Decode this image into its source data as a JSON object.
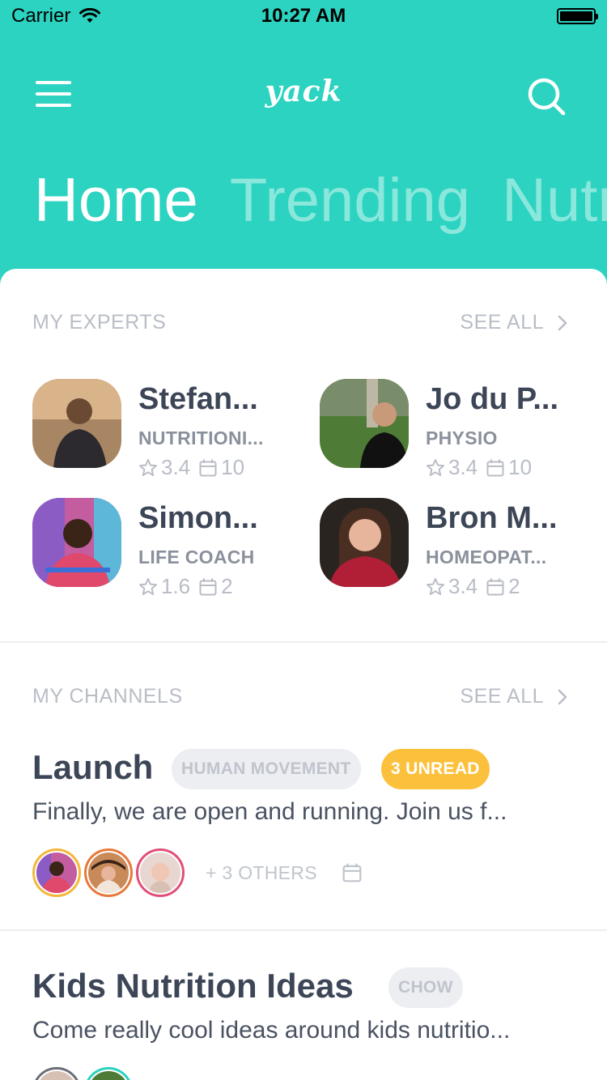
{
  "status_bar": {
    "carrier": "Carrier",
    "time": "10:27 AM"
  },
  "navbar": {
    "logo": "yack"
  },
  "tabs": [
    {
      "label": "Home",
      "active": true
    },
    {
      "label": "Trending",
      "active": false
    },
    {
      "label": "Nutr",
      "active": false
    }
  ],
  "experts_section": {
    "header": "MY EXPERTS",
    "see_all": "SEE ALL"
  },
  "experts": [
    {
      "name": "Stefan...",
      "role": "NUTRITIONI...",
      "rating": "3.4",
      "sessions": "10",
      "avatar_bg": "#8a6a4f"
    },
    {
      "name": "Jo du P...",
      "role": "PHYSIO",
      "rating": "3.4",
      "sessions": "10",
      "avatar_bg": "#4f7a3a"
    },
    {
      "name": "Simon...",
      "role": "LIFE COACH",
      "rating": "1.6",
      "sessions": "2",
      "avatar_bg": "#c45ca0"
    },
    {
      "name": "Bron M...",
      "role": "HOMEOPAT...",
      "rating": "3.4",
      "sessions": "2",
      "avatar_bg": "#b01f35"
    }
  ],
  "channels_section": {
    "header": "MY CHANNELS",
    "see_all": "SEE ALL"
  },
  "channels": [
    {
      "title": "Launch",
      "tag": "HUMAN MOVEMENT",
      "unread": "3 UNREAD",
      "description": "Finally, we are open and running. Join us f...",
      "others": "+ 3 OTHERS"
    },
    {
      "title": "Kids Nutrition Ideas",
      "tag": "CHOW",
      "description": "Come really cool ideas around kids nutritio..."
    }
  ],
  "colors": {
    "brand": "#2bd3c0",
    "unread": "#fcc13c",
    "member_ring_1": "#f4b73a",
    "member_ring_2": "#e8793a",
    "member_ring_3": "#e0507a"
  }
}
